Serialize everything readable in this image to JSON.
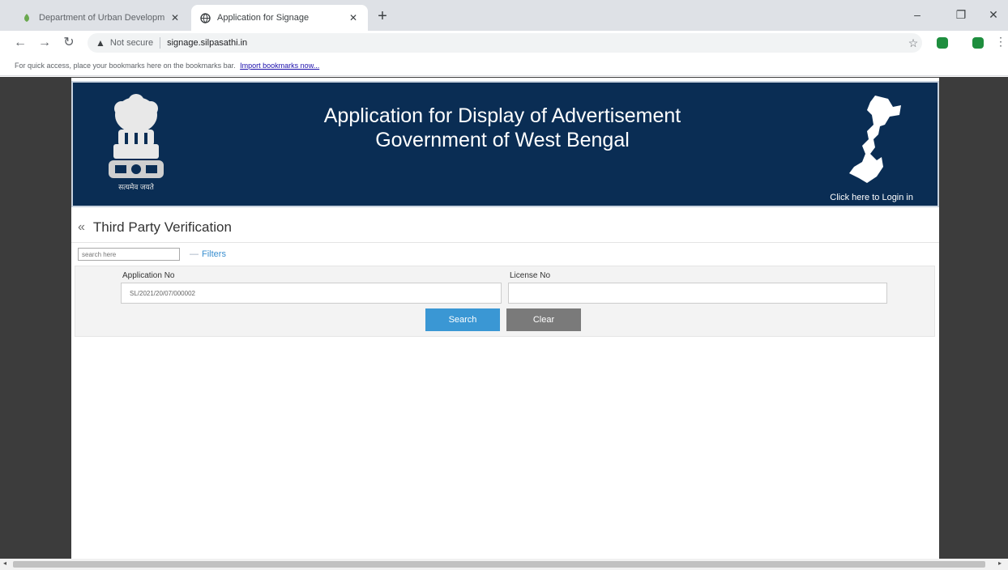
{
  "browser": {
    "tabs": [
      {
        "title": "Department of Urban Developm",
        "active": false
      },
      {
        "title": "Application for Signage",
        "active": true
      }
    ],
    "new_tab": "+",
    "window_controls": {
      "minimize": "–",
      "restore": "❐",
      "close": "✕"
    },
    "address": {
      "security_label": "Not secure",
      "url": "signage.silpasathi.in"
    },
    "bookmarks_bar": {
      "message": "For quick access, place your bookmarks here on the bookmarks bar.",
      "import_link": "Import bookmarks now..."
    },
    "extension_colors": [
      "#1e8e3e",
      "#1e8e3e"
    ]
  },
  "banner": {
    "title_line1": "Application for Display of Advertisement",
    "title_line2": "Government of West Bengal",
    "login_link": "Click here to Login in",
    "background_color": "#0a2d54",
    "emblem_icon": "ashoka-emblem-icon",
    "emblem_caption": "सत्यमेव जयते",
    "map_icon": "west-bengal-map-icon"
  },
  "page": {
    "title": "Third Party Verification",
    "back_icon": "double-chevron-left-icon"
  },
  "toolbar": {
    "search_placeholder": "search here",
    "filters_label": "Filters"
  },
  "form": {
    "application_no_label": "Application No",
    "application_no_value": "SL/2021/20/07/000002",
    "license_no_label": "License No",
    "license_no_value": "",
    "search_button": "Search",
    "clear_button": "Clear",
    "search_color": "#3a97d4",
    "clear_color": "#7a7a7a"
  }
}
